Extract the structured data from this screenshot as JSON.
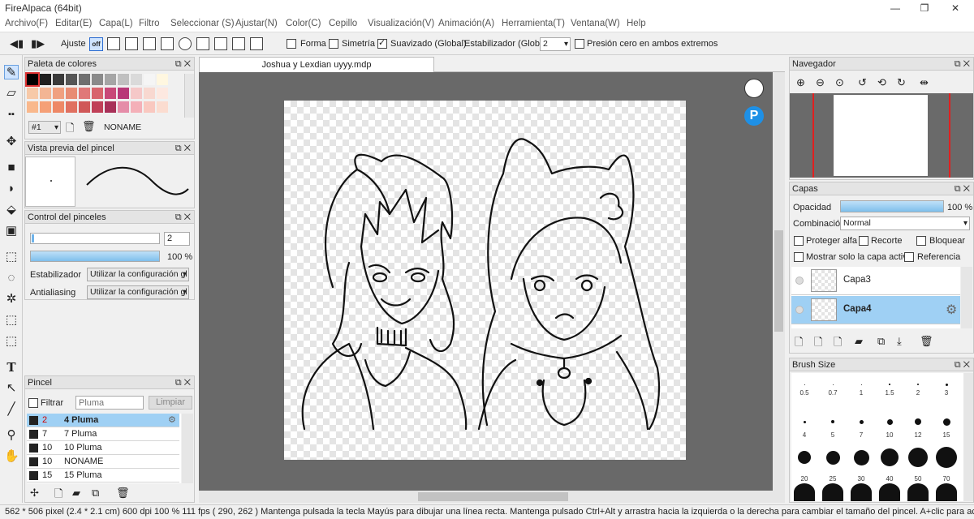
{
  "app": {
    "title": "FireAlpaca (64bit)"
  },
  "window_controls": [
    "—",
    "❐",
    "✕"
  ],
  "menu": [
    "Archivo(F)",
    "Editar(E)",
    "Capa(L)",
    "Filtro",
    "Seleccionar (S)",
    "Ajustar(N)",
    "Color(C)",
    "Cepillo",
    "Visualización(V)",
    "Animación(A)",
    "Herramienta(T)",
    "Ventana(W)",
    "Help"
  ],
  "toolbar": {
    "adjust_label": "Ajuste",
    "off_label": "off",
    "shape_label": "Forma",
    "symmetry_label": "Simetría",
    "smoothing_label": "Suavizado (Global)",
    "stabilizer_label": "Estabilizador (Global)",
    "stabilizer_value": "2",
    "pressure_label": "Presión cero en ambos extremos"
  },
  "document": {
    "tab_title": "Joshua y Lexdian uyyy.mdp"
  },
  "palette": {
    "title": "Paleta de colores",
    "index": "#1",
    "name": "NONAME",
    "row1": [
      "#000000",
      "#1f1f1f",
      "#3a3a3a",
      "#555555",
      "#6f6f6f",
      "#8a8a8a",
      "#a5a5a5",
      "#c0c0c0",
      "#dadada",
      "#f5f5f5",
      "#fff7e0"
    ],
    "row2": [
      "#f7c9a8",
      "#f3b594",
      "#f0a080",
      "#e88c74",
      "#e07878",
      "#d8646c",
      "#c84878",
      "#b83878",
      "#f5c8c8",
      "#f8d8d0",
      "#fde8e0"
    ],
    "row3": [
      "#f9b88c",
      "#f5a077",
      "#ee8866",
      "#e07060",
      "#d05858",
      "#c04058",
      "#a83058",
      "#e58ca8",
      "#f4b0b8",
      "#f9c8c0",
      "#fbdcd0"
    ]
  },
  "brush_preview": {
    "title": "Vista previa del pincel"
  },
  "brush_control": {
    "title": "Control del pinceles",
    "size_value": "2",
    "opacity_value": "100 %",
    "opacity_fraction": 1.0,
    "stabilizer_label": "Estabilizador",
    "stabilizer_value": "Utilizar la configuración gl",
    "antialiasing_label": "Antialiasing",
    "antialiasing_value": "Utilizar la configuración gl"
  },
  "brush_list": {
    "title": "Pincel",
    "filter_label": "Filtrar",
    "filter_placeholder": "Pluma",
    "clear_label": "Limpiar",
    "items": [
      {
        "size": "2",
        "name": "4 Pluma",
        "selected": true
      },
      {
        "size": "7",
        "name": "7 Pluma",
        "selected": false
      },
      {
        "size": "10",
        "name": "10 Pluma",
        "selected": false
      },
      {
        "size": "10",
        "name": "NONAME",
        "selected": false
      },
      {
        "size": "15",
        "name": "15 Pluma",
        "selected": false
      }
    ]
  },
  "navigator": {
    "title": "Navegador"
  },
  "layers": {
    "title": "Capas",
    "opacity_label": "Opacidad",
    "opacity_value": "100 %",
    "opacity_fraction": 1.0,
    "blend_label": "Combinación",
    "blend_value": "Normal",
    "protect_alpha": "Proteger alfa",
    "clip": "Recorte",
    "lock": "Bloquear",
    "show_active_only": "Mostrar solo la capa activa",
    "reference": "Referencia",
    "items": [
      {
        "name": "Capa3",
        "selected": false
      },
      {
        "name": "Capa4",
        "selected": true
      }
    ]
  },
  "brush_size": {
    "title": "Brush Size",
    "row1": [
      "0.5",
      "0.7",
      "1",
      "1.5",
      "2",
      "3"
    ],
    "row2": [
      "4",
      "5",
      "7",
      "10",
      "12",
      "15"
    ],
    "row3": [
      "20",
      "25",
      "30",
      "40",
      "50",
      "70"
    ]
  },
  "status": {
    "text": "562 * 506 pixel   (2.4 * 2.1 cm)   600 dpi   100 %   111 fps   ( 290, 262 )   Mantenga pulsada la tecla Mayús para dibujar una línea recta. Mantenga pulsado Ctrl+Alt y arrastra hacia la izquierda o la derecha para cambiar el tamaño del pincel. A+clic para activar la"
  }
}
